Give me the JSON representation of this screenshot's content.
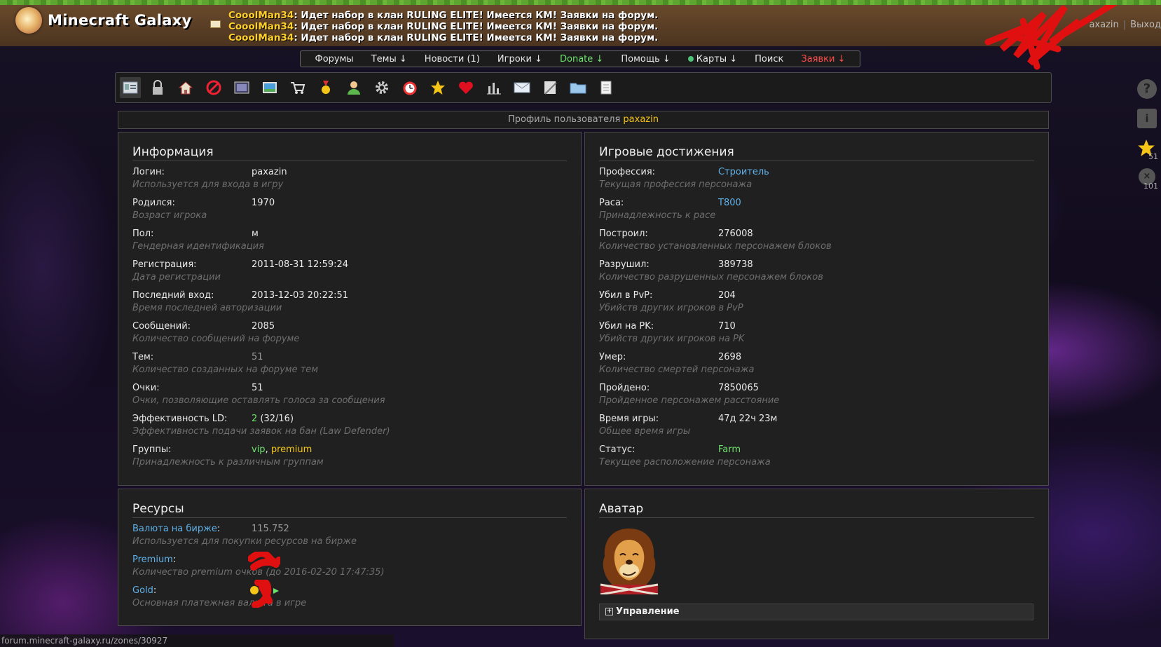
{
  "header": {
    "site_title": "Minecraft Galaxy",
    "news": [
      {
        "author": "CooolMan34",
        "text": ": Идет набор в клан RULING ELITE! Имеется КМ! Заявки на форум."
      },
      {
        "author": "CooolMan34",
        "text": ": Идет набор в клан RULING ELITE! Имеется КМ! Заявки на форум."
      },
      {
        "author": "CooolMan34",
        "text": ": Идет набор в клан RULING ELITE! Имеется КМ! Заявки на форум."
      }
    ],
    "user_link": "axazin",
    "separator": "|",
    "logout": "Выход"
  },
  "nav": {
    "forums": "Форумы",
    "topics": "Темы ↓",
    "news": "Новости (1)",
    "players": "Игроки ↓",
    "donate": "Donate ↓",
    "help": "Помощь ↓",
    "maps": "Карты ↓",
    "search": "Поиск",
    "requests": "Заявки ↓"
  },
  "profile_header": {
    "prefix": "Профиль пользователя ",
    "username": "paxazin"
  },
  "info": {
    "title": "Информация",
    "rows": [
      {
        "label": "Логин:",
        "value": "paxazin",
        "desc": "Используется для входа в игру"
      },
      {
        "label": "Родился:",
        "value": "1970",
        "desc": "Возраст игрока"
      },
      {
        "label": "Пол:",
        "value": "м",
        "desc": "Гендерная идентификация"
      },
      {
        "label": "Регистрация:",
        "value": "2011-08-31 12:59:24",
        "desc": "Дата регистрации"
      },
      {
        "label": "Последний вход:",
        "value": "2013-12-03 20:22:51",
        "desc": "Время последней авторизации"
      },
      {
        "label": "Сообщений:",
        "value": "2085",
        "desc": "Количество сообщений на форуме"
      },
      {
        "label": "Тем:",
        "value": "51",
        "desc": "Количество созданных на форуме тем"
      },
      {
        "label": "Очки:",
        "value": "51",
        "desc": "Очки, позволяющие оставлять голоса за сообщения"
      },
      {
        "label": "Эффективность LD:",
        "value_main": "2",
        "value_rest": " (32/16)",
        "desc": "Эффективность подачи заявок на бан (Law Defender)"
      },
      {
        "label": "Группы:",
        "group1": "vip",
        "comma": ", ",
        "group2": "premium",
        "desc": "Принадлежность к различным группам"
      }
    ]
  },
  "achievements": {
    "title": "Игровые достижения",
    "rows": [
      {
        "label": "Профессия:",
        "value": "Строитель",
        "desc": "Текущая профессия персонажа"
      },
      {
        "label": "Раса:",
        "value": "T800",
        "desc": "Принадлежность к расе"
      },
      {
        "label": "Построил:",
        "value": "276008",
        "desc": "Количество установленных персонажем блоков"
      },
      {
        "label": "Разрушил:",
        "value": "389738",
        "desc": "Количество разрушенных персонажем блоков"
      },
      {
        "label": "Убил в PvP:",
        "value": "204",
        "desc": "Убийств других игроков в PvP"
      },
      {
        "label": "Убил на PK:",
        "value": "710",
        "desc": "Убийств других игроков на PK"
      },
      {
        "label": "Умер:",
        "value": "2698",
        "desc": "Количество смертей персонажа"
      },
      {
        "label": "Пройдено:",
        "value": "7850065",
        "desc": "Пройденное персонажем расстояние"
      },
      {
        "label": "Время игры:",
        "value": "47д 22ч 23м",
        "desc": "Общее время игры"
      },
      {
        "label": "Статус:",
        "value": "Farm",
        "desc": "Текущее расположение персонажа"
      }
    ]
  },
  "resources": {
    "title": "Ресурсы",
    "rows": [
      {
        "label": "Валюта на бирже",
        "colon": ":",
        "value": "115.752",
        "desc": "Используется для покупки ресурсов на бирже"
      },
      {
        "label": "Premium",
        "colon": ":",
        "value": "",
        "desc": "Количество premium очков (до 2016-02-20 17:47:35)"
      },
      {
        "label": "Gold",
        "colon": ":",
        "value": "",
        "desc": "Основная платежная валюта в игре"
      }
    ]
  },
  "avatar": {
    "title": "Аватар",
    "manage_label": "Управление"
  },
  "sidebar_right": {
    "star_count": "51",
    "x_count": "101"
  },
  "status_bar": "forum.minecraft-galaxy.ru/zones/30927",
  "colors": {
    "accent_yellow": "#f5c518",
    "link_blue": "#5fb1e8",
    "green": "#6ee26e",
    "red": "#ff4d4d"
  }
}
